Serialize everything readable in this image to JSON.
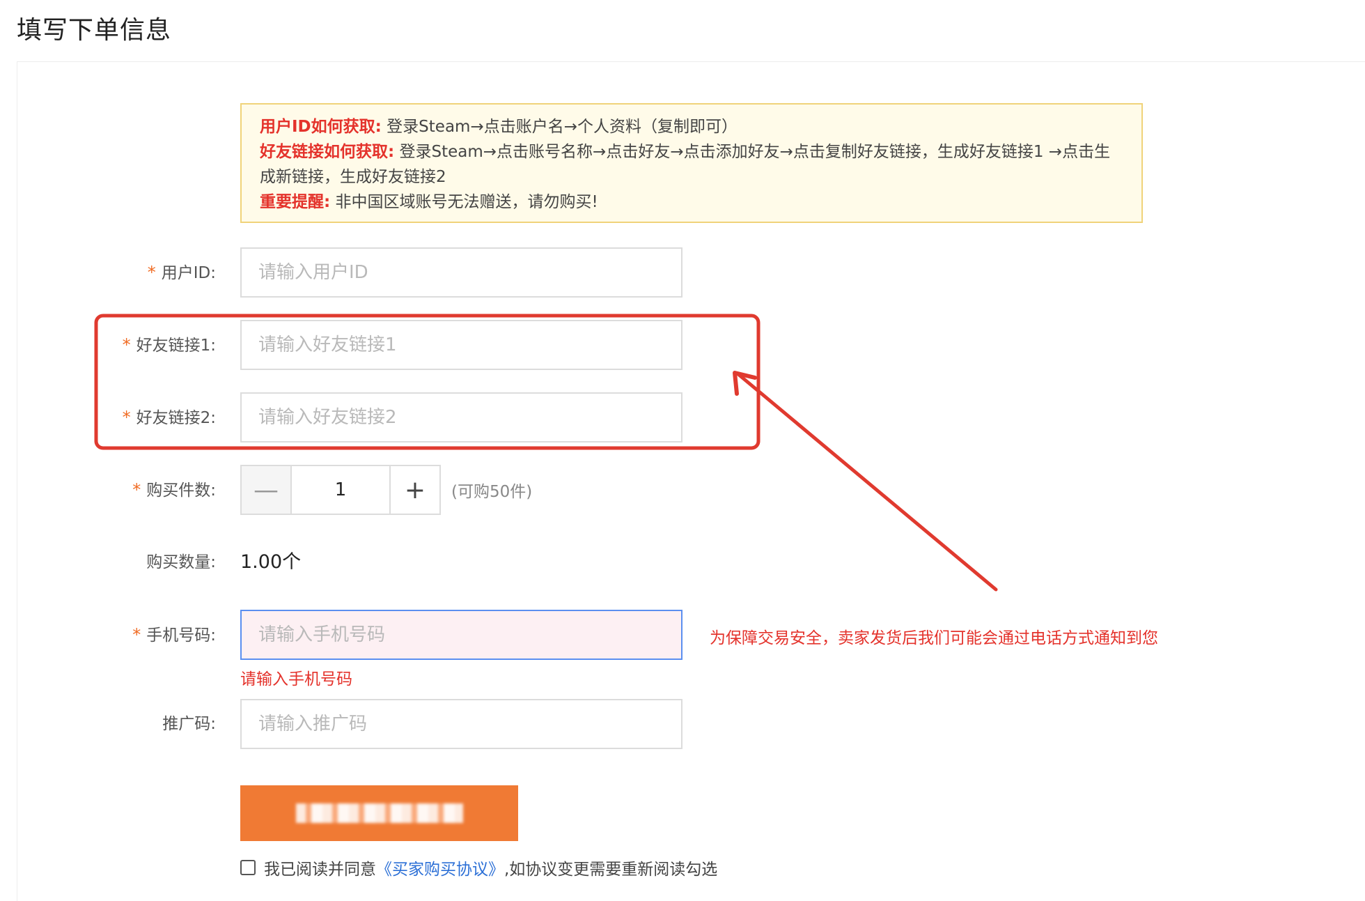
{
  "page": {
    "title": "填写下单信息"
  },
  "notice": {
    "user_id_key": "用户ID如何获取:",
    "user_id_text": " 登录Steam→点击账户名→个人资料（复制即可）",
    "friend_link_key": "好友链接如何获取:",
    "friend_link_text": " 登录Steam→点击账号名称→点击好友→点击添加好友→点击复制好友链接，生成好友链接1 →点击生成新链接，生成好友链接2",
    "warning_key": "重要提醒:",
    "warning_text": " 非中国区域账号无法赠送，请勿购买!"
  },
  "form": {
    "required_mark": "*",
    "user_id": {
      "label": "用户ID:",
      "value": "",
      "placeholder": "请输入用户ID"
    },
    "friend_link_1": {
      "label": "好友链接1:",
      "value": "",
      "placeholder": "请输入好友链接1"
    },
    "friend_link_2": {
      "label": "好友链接2:",
      "value": "",
      "placeholder": "请输入好友链接2"
    },
    "quantity": {
      "label": "购买件数:",
      "minus_symbol": "—",
      "plus_symbol": "+",
      "value": "1",
      "limit_hint": "(可购50件)"
    },
    "amount": {
      "label": "购买数量:",
      "value": "1.00个"
    },
    "phone": {
      "label": "手机号码:",
      "value": "",
      "placeholder": "请输入手机号码",
      "error": "请输入手机号码",
      "security_note": "为保障交易安全，卖家发货后我们可能会通过电话方式通知到您"
    },
    "promo_code": {
      "label": "推广码:",
      "value": "",
      "placeholder": "请输入推广码"
    }
  },
  "agreement": {
    "prefix": "我已阅读并同意",
    "link": "《买家购买协议》",
    "suffix": ",如协议变更需要重新阅读勾选"
  },
  "colors": {
    "accent_orange": "#f07a34",
    "error_red": "#e4322b",
    "notice_border": "#f0d37a",
    "notice_bg": "#fffbe9",
    "link_blue": "#2b6fd6",
    "annotation_red": "#e03a2f"
  }
}
